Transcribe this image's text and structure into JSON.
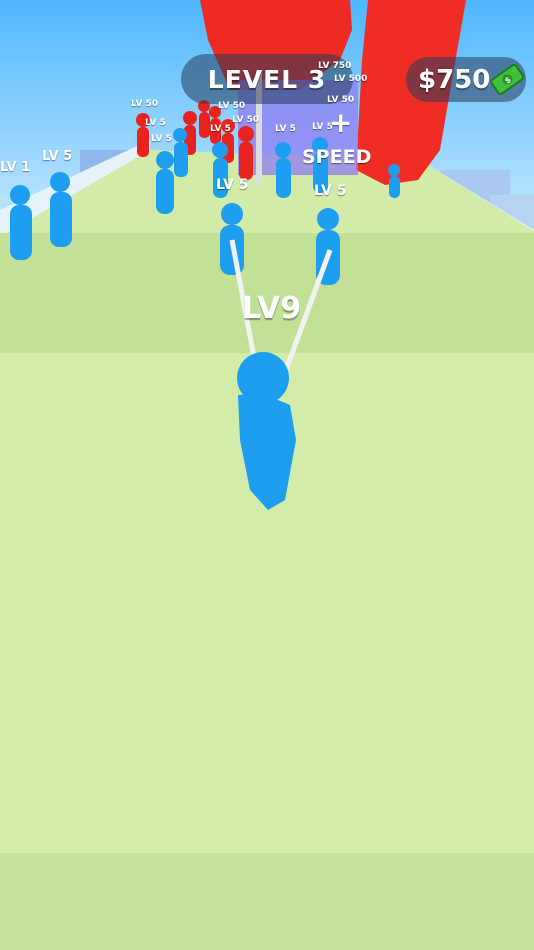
{
  "hud": {
    "level_text": "LEVEL 3",
    "money_text": "$750",
    "cash_icon": "cash-bill-icon"
  },
  "player": {
    "level_text": "LV9"
  },
  "allies": [
    {
      "level_text": "LV 5"
    },
    {
      "level_text": "LV 5"
    }
  ],
  "crowd_labels": {
    "left_lv1": "LV 1",
    "left_lv5": "LV 5",
    "lv5_a": "LV 5",
    "lv5_b": "LV 5",
    "lv5_c": "LV 5",
    "lv5_d": "LV 5",
    "lv5_e": "LV 5",
    "lv50_a": "LV 50",
    "lv50_b": "LV 50",
    "lv50_c": "LV 50",
    "lv50_d": "LV 50",
    "lv500": "LV 500",
    "lv750": "LV 750"
  },
  "gate": {
    "symbol": "+",
    "label": "SPEED"
  },
  "colors": {
    "sky": "#6ec6ff",
    "track": "#d3eba8",
    "track_shadow": "#bcd893",
    "ally_blue": "#1e9ef0",
    "enemy_red": "#e8231d",
    "hud_bg": "#3c4e66",
    "cash_green": "#3fbf3a"
  }
}
